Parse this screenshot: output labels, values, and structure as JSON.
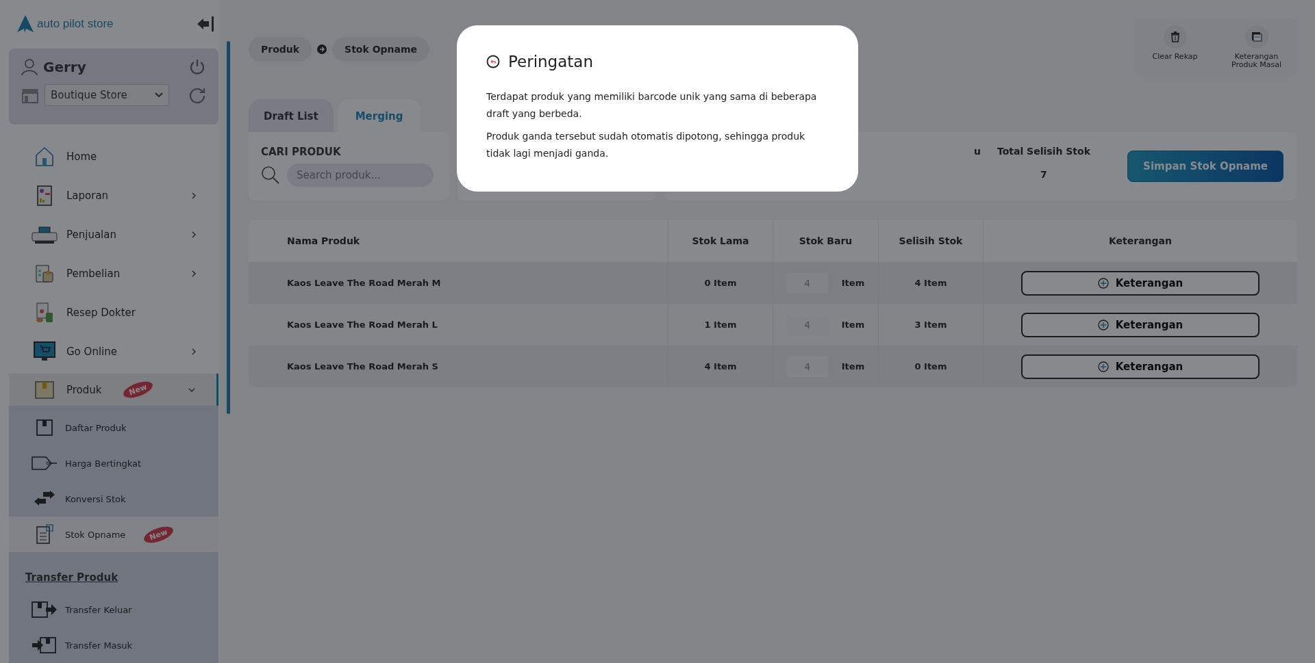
{
  "logo": {
    "text": "auto pilot store"
  },
  "user": {
    "name": "Gerry",
    "store": "Boutique Store"
  },
  "menu": [
    {
      "label": "Home",
      "has_submenu": false
    },
    {
      "label": "Laporan",
      "has_submenu": true
    },
    {
      "label": "Penjualan",
      "has_submenu": true
    },
    {
      "label": "Pembelian",
      "has_submenu": true
    },
    {
      "label": "Resep Dokter",
      "has_submenu": false
    },
    {
      "label": "Go Online",
      "has_submenu": true
    },
    {
      "label": "Produk",
      "has_submenu": true,
      "expanded": true,
      "badge": "New",
      "children": [
        {
          "label": "Daftar Produk",
          "selected": false
        },
        {
          "label": "Harga Bertingkat",
          "selected": false
        },
        {
          "label": "Konversi Stok",
          "selected": false
        },
        {
          "label": "Stok Opname",
          "selected": true,
          "badge": "New"
        }
      ]
    }
  ],
  "transfer": {
    "heading": "Transfer Produk",
    "items": [
      {
        "label": "Transfer Keluar"
      },
      {
        "label": "Transfer Masuk"
      }
    ]
  },
  "breadcrumb": [
    "Produk",
    "Stok Opname"
  ],
  "actions": [
    {
      "label": "Clear Rekap"
    },
    {
      "label": "Keterangan Produk Masal"
    }
  ],
  "tabs": [
    {
      "label": "Draft List",
      "selected": false
    },
    {
      "label": "Merging",
      "selected": true
    }
  ],
  "search": {
    "label": "CARI PRODUK",
    "placeholder": "Search produk..."
  },
  "summary": [
    {
      "label": "u"
    },
    {
      "label": "Total Selisih Stok",
      "value": "7"
    }
  ],
  "save_button": "Simpan Stok Opname",
  "table": {
    "columns": [
      "Nama Produk",
      "Stok Lama",
      "Stok Baru",
      "Selisih Stok",
      "Keterangan"
    ],
    "rows": [
      {
        "name": "Kaos Leave The Road Merah M",
        "old": "0 Item",
        "new_value": "4",
        "new_unit": "Item",
        "diff": "4 Item",
        "note": "Keterangan"
      },
      {
        "name": "Kaos Leave The Road Merah L",
        "old": "1 Item",
        "new_value": "4",
        "new_unit": "Item",
        "diff": "3 Item",
        "note": "Keterangan"
      },
      {
        "name": "Kaos Leave The Road Merah S",
        "old": "4 Item",
        "new_value": "4",
        "new_unit": "Item",
        "diff": "0 Item",
        "note": "Keterangan"
      }
    ]
  },
  "dialog": {
    "title": "Peringatan",
    "paragraphs": [
      "Terdapat produk yang memiliki barcode unik yang sama di beberapa draft yang berbeda.",
      "Produk ganda tersebut sudah otomatis dipotong, sehingga produk tidak lagi menjadi ganda."
    ]
  }
}
